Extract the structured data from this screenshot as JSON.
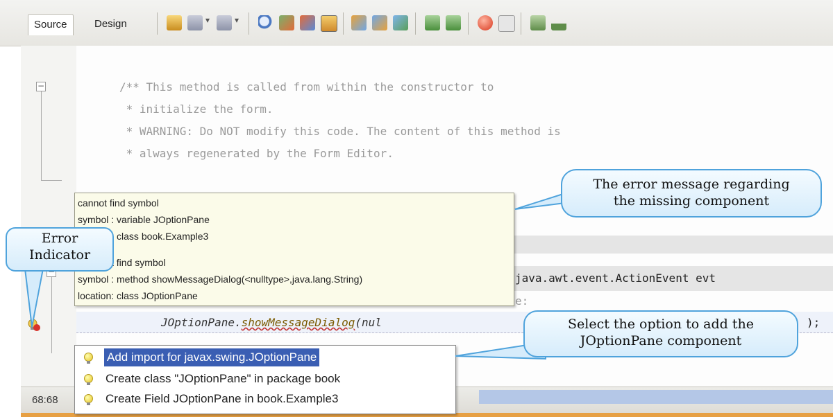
{
  "toolbar": {
    "tabs": [
      "Source",
      "Design"
    ],
    "icons": [
      "history-icon",
      "back-icon",
      "forward-icon",
      "find-icon",
      "find-prev-icon",
      "find-next-icon",
      "toggle-highlight-icon",
      "prev-bookmark-icon",
      "next-bookmark-icon",
      "toggle-bookmark-icon",
      "shift-left-icon",
      "shift-right-icon",
      "record-macro-icon",
      "stop-macro-icon",
      "comment-icon",
      "uncomment-icon"
    ]
  },
  "code": {
    "comment_line1": "/** This method is called from within the constructor to",
    "comment_line2": " * initialize the form.",
    "comment_line3": " * WARNING: Do NOT modify this code. The content of this method is",
    "comment_line4": " * always regenerated by the Form Editor.",
    "method_sig_tail": "java.awt.event.ActionEvent evt",
    "comment_fragment": "e:",
    "call_class": "JOptionPane.",
    "call_method": "showMessageDialog",
    "call_args": "(nul",
    "call_end": ");"
  },
  "tooltip": {
    "error1_title": "cannot find symbol",
    "error1_symbol": "symbol : variable JOptionPane",
    "error1_location": "location: class book.Example3",
    "error2_title": "t find symbol",
    "error2_symbol": "symbol : method showMessageDialog(<nulltype>,java.lang.String)",
    "error2_location": "location: class JOptionPane"
  },
  "hints": [
    {
      "label": "Add import for javax.swing.JOptionPane",
      "selected": true
    },
    {
      "label": "Create class \"JOptionPane\" in package book",
      "selected": false
    },
    {
      "label": "Create Field JOptionPane in book.Example3",
      "selected": false
    }
  ],
  "status": {
    "position": "68:68"
  },
  "callouts": {
    "error_message": [
      "The error message regarding",
      "the missing component"
    ],
    "error_indicator": [
      "Error",
      "Indicator"
    ],
    "select_option": [
      "Select the option to add the",
      "JOptionPane component"
    ]
  },
  "colors": {
    "callout_border": "#4fa3dc",
    "selection": "#3a5eb3",
    "tooltip_bg": "#fbfbe9"
  }
}
